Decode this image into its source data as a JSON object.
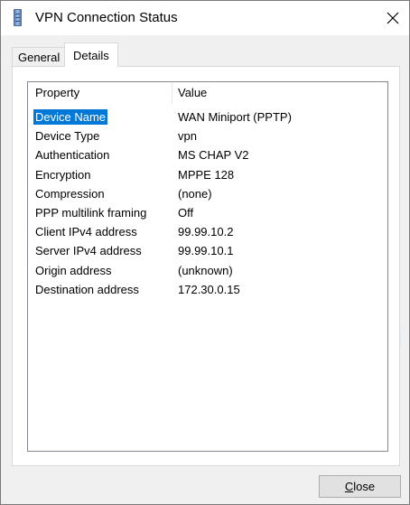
{
  "window": {
    "title": "VPN Connection Status",
    "icon": "vpn-connection-icon",
    "close_icon": "close-icon"
  },
  "tabs": [
    {
      "label": "General",
      "selected": false
    },
    {
      "label": "Details",
      "selected": true
    }
  ],
  "details": {
    "columns": {
      "property": "Property",
      "value": "Value"
    },
    "rows": [
      {
        "property": "Device Name",
        "value": "WAN Miniport (PPTP)",
        "selected": true
      },
      {
        "property": "Device Type",
        "value": "vpn"
      },
      {
        "property": "Authentication",
        "value": "MS CHAP V2"
      },
      {
        "property": "Encryption",
        "value": "MPPE 128"
      },
      {
        "property": "Compression",
        "value": "(none)"
      },
      {
        "property": "PPP multilink framing",
        "value": "Off"
      },
      {
        "property": "Client IPv4 address",
        "value": "99.99.10.2"
      },
      {
        "property": "Server IPv4 address",
        "value": "99.99.10.1"
      },
      {
        "property": "Origin address",
        "value": "(unknown)"
      },
      {
        "property": "Destination address",
        "value": "172.30.0.15"
      }
    ]
  },
  "buttons": {
    "close_mnemonic": "C",
    "close_rest": "lose"
  },
  "colors": {
    "selection": "#0078d7",
    "window_bg": "#f0f0f0",
    "panel_bg": "#ffffff"
  }
}
